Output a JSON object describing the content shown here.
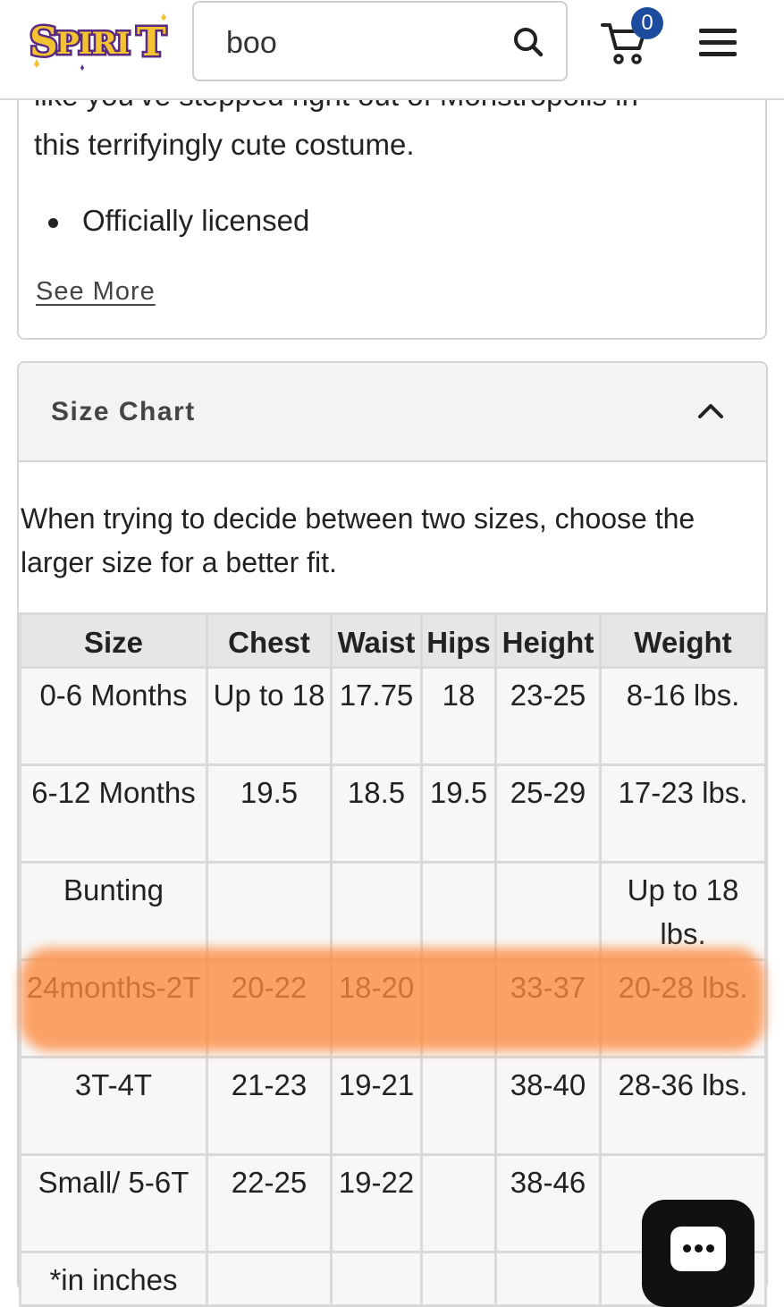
{
  "header": {
    "logo_text": "SPIRIT",
    "search_value": "boo",
    "cart_count": "0",
    "icons": {
      "search": "search-icon",
      "cart": "cart-icon",
      "menu": "hamburger-menu-icon"
    }
  },
  "description": {
    "partial_line": "like you've stepped right out of Monstropolis in",
    "line": "this terrifyingly cute costume.",
    "bullets": [
      "Officially licensed"
    ],
    "see_more": "See More"
  },
  "size_chart": {
    "title": "Size Chart",
    "expanded": true,
    "note": "When trying to decide between two sizes, choose the larger size for a better fit.",
    "columns": [
      "Size",
      "Chest",
      "Waist",
      "Hips",
      "Height",
      "Weight"
    ],
    "rows": [
      [
        "0-6 Months",
        "Up to 18",
        "17.75",
        "18",
        "23-25",
        "8-16 lbs."
      ],
      [
        "6-12 Months",
        "19.5",
        "18.5",
        "19.5",
        "25-29",
        "17-23 lbs."
      ],
      [
        "Bunting",
        "",
        "",
        "",
        "",
        "Up to 18 lbs."
      ],
      [
        "24months-2T",
        "20-22",
        "18-20",
        "",
        "33-37",
        "20-28 lbs."
      ],
      [
        "3T-4T",
        "21-23",
        "19-21",
        "",
        "38-40",
        "28-36 lbs."
      ],
      [
        "Small/ 5-6T",
        "22-25",
        "19-22",
        "",
        "38-46",
        ""
      ],
      [
        "*in inches",
        "",
        "",
        "",
        "",
        ""
      ]
    ],
    "highlighted_row": "24months-2T",
    "highlight_color": "#fd8a3f"
  },
  "colors": {
    "badge": "#1d4c9e",
    "logo_gold": "#f2c230",
    "logo_purple": "#5a2a82"
  },
  "chat": {
    "icon": "chat-bubble-icon"
  }
}
